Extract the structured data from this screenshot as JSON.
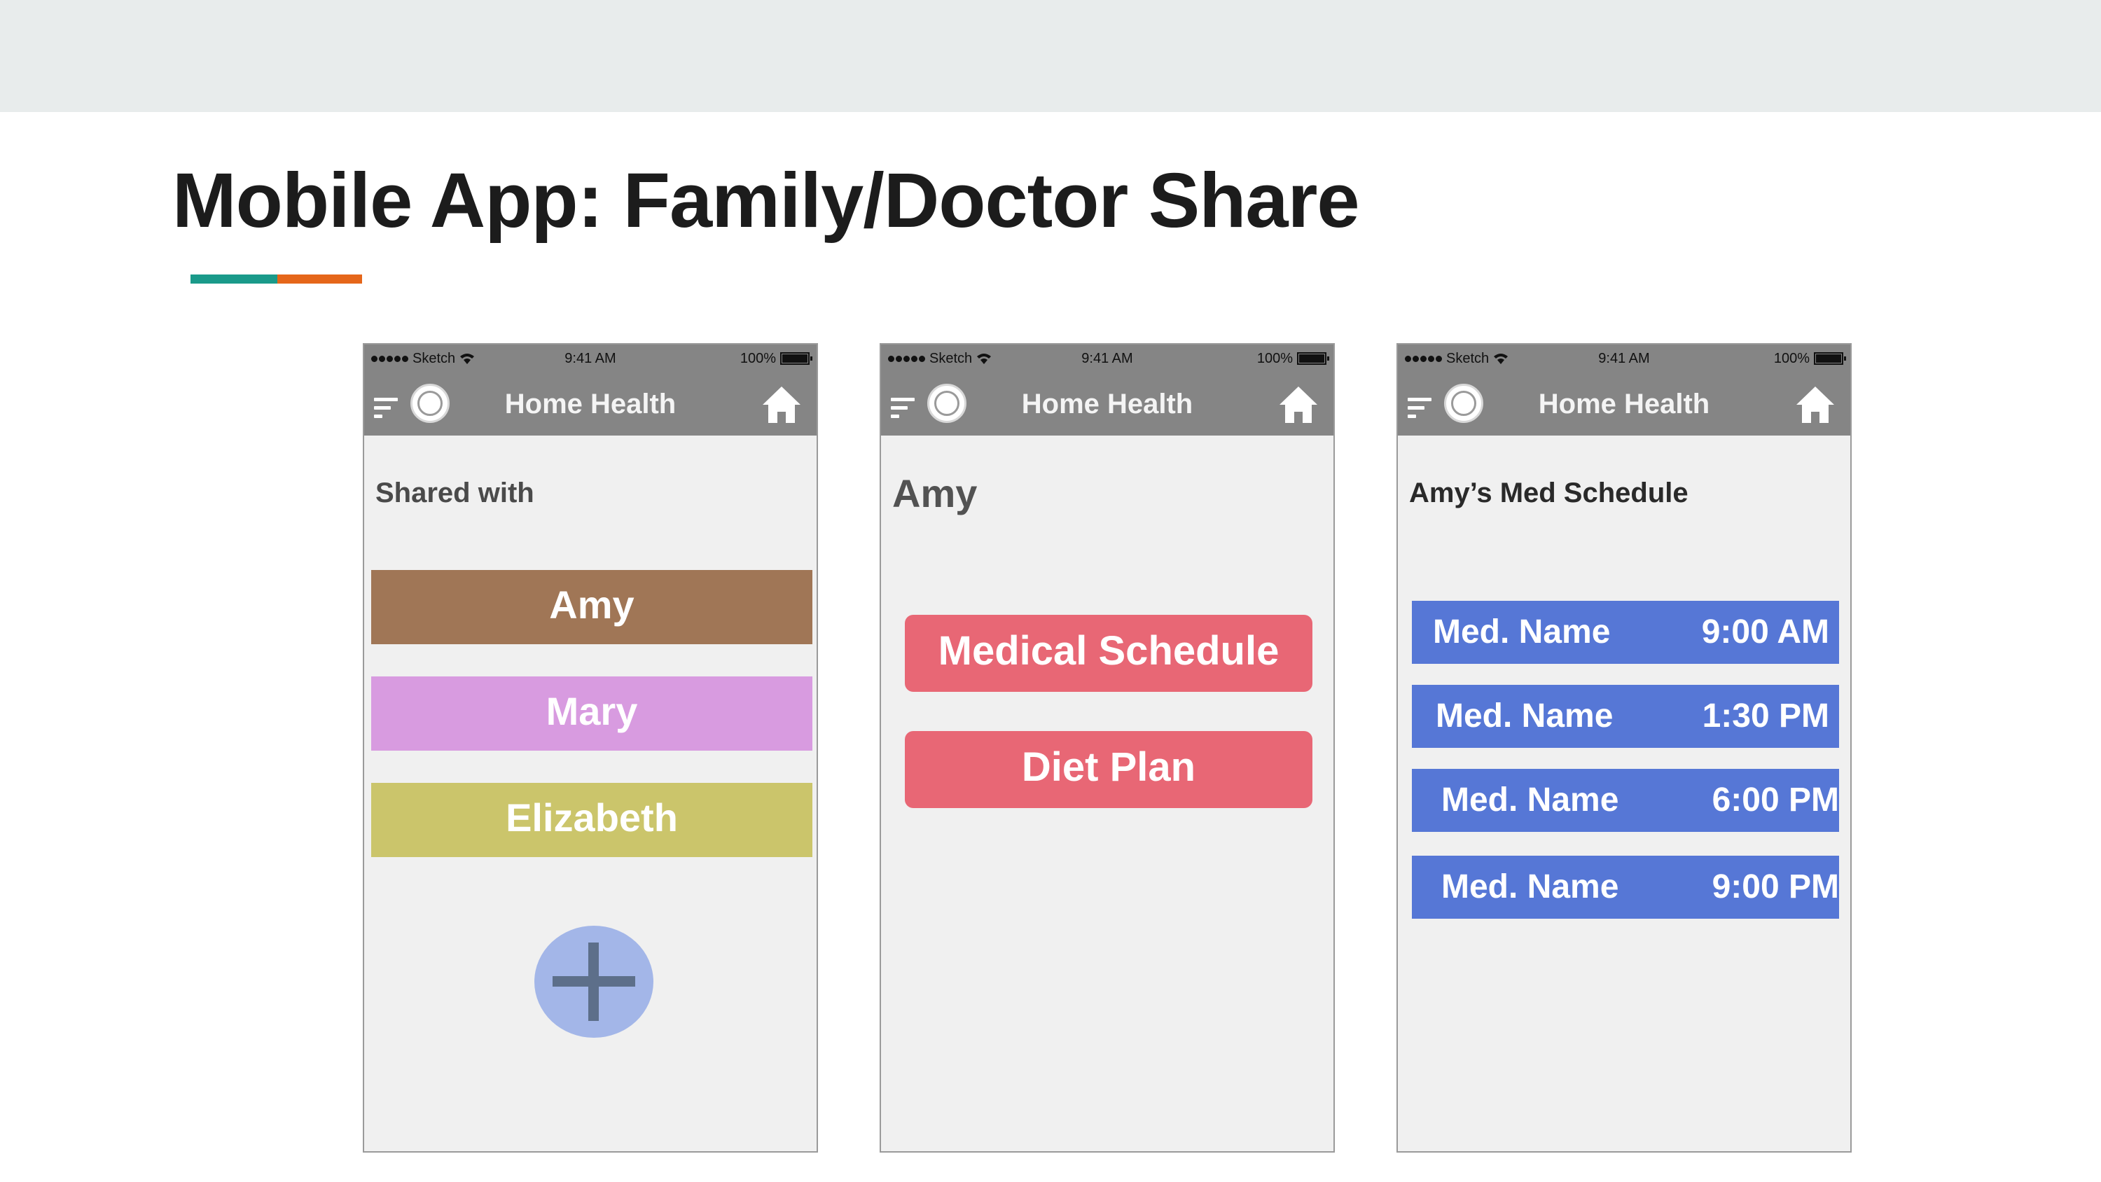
{
  "slide": {
    "title": "Mobile App: Family/Doctor Share",
    "accent_colors": [
      "#1a9a8a",
      "#e5661a"
    ]
  },
  "status_bar": {
    "carrier": "Sketch",
    "time": "9:41 AM",
    "battery": "100%"
  },
  "nav": {
    "title": "Home Health",
    "icons": [
      "menu-icon",
      "ge-logo-icon",
      "home-icon"
    ]
  },
  "screen_shared": {
    "title": "Shared with",
    "contacts": [
      {
        "label": "Amy",
        "color": "#a07656"
      },
      {
        "label": "Mary",
        "color": "#d89be0"
      },
      {
        "label": "Elizabeth",
        "color": "#cbc56b"
      }
    ],
    "add_icon": "plus-icon"
  },
  "screen_amy": {
    "title": "Amy",
    "buttons": [
      {
        "label": "Medical Schedule",
        "color": "#e86775"
      },
      {
        "label": "Diet Plan",
        "color": "#e86775"
      }
    ]
  },
  "screen_schedule": {
    "title": "Amy’s Med Schedule",
    "rows": [
      {
        "name": "Med. Name",
        "time": "9:00 AM"
      },
      {
        "name": "Med. Name",
        "time": "1:30 PM"
      },
      {
        "name": "Med. Name",
        "time": "6:00 PM"
      },
      {
        "name": "Med. Name",
        "time": "9:00 PM"
      }
    ],
    "row_color": "#5677d6"
  }
}
